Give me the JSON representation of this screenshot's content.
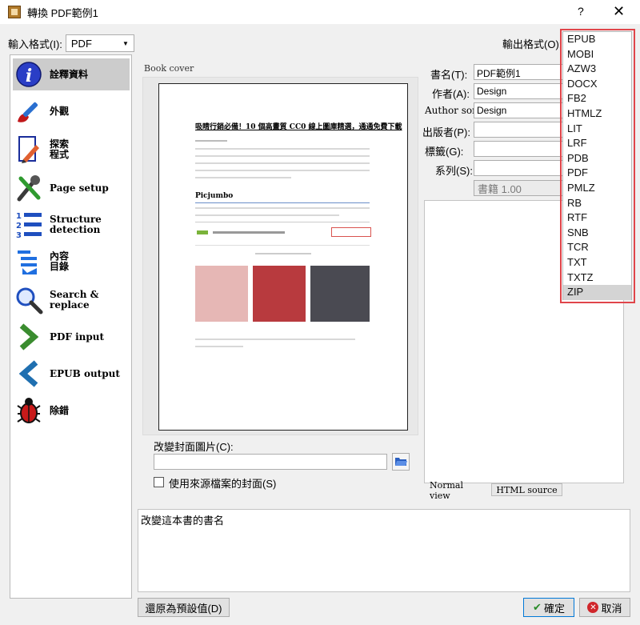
{
  "window": {
    "title": "轉換 PDF範例1",
    "help": "?",
    "close": "✕"
  },
  "input_format": {
    "label": "輸入格式(I):",
    "value": "PDF"
  },
  "output_format": {
    "label": "輸出格式(O):"
  },
  "sidebar": {
    "items": [
      {
        "label": "詮釋資料",
        "icon": "info-icon"
      },
      {
        "label": "外觀",
        "icon": "paintbrush-icon"
      },
      {
        "label": "探索\n程式",
        "icon": "document-pencil-icon"
      },
      {
        "label": "Page setup",
        "icon": "wrench-screwdriver-icon"
      },
      {
        "label": "Structure\ndetection",
        "icon": "numbered-list-icon"
      },
      {
        "label": "內容\n目錄",
        "icon": "toc-list-icon"
      },
      {
        "label": "Search &\nreplace",
        "icon": "magnifier-icon"
      },
      {
        "label": "PDF input",
        "icon": "arrow-right-icon"
      },
      {
        "label": "EPUB output",
        "icon": "arrow-left-icon"
      },
      {
        "label": "除錯",
        "icon": "bug-icon"
      }
    ]
  },
  "cover": {
    "label": "Book cover",
    "preview_title": "吸睛行銷必備！10 個高畫質 CC0 線上圖庫精選，通通免費下載",
    "preview_section": "Picjumbo",
    "change_label": "改變封面圖片(C):",
    "path_value": "",
    "use_source_label": "使用來源檔案的封面(S)"
  },
  "metadata": {
    "title_label": "書名(T):",
    "title_value": "PDF範例1",
    "author_label": "作者(A):",
    "author_value": "Design",
    "author_sort_label": "Author sort:",
    "author_sort_value": "Design",
    "publisher_label": "出版者(P):",
    "publisher_value": "",
    "tags_label": "標籤(G):",
    "tags_value": "",
    "series_label": "系列(S):",
    "series_value": "",
    "series_index": "書籍 1.00"
  },
  "preview_tabs": {
    "normal": "Normal view",
    "html": "HTML source"
  },
  "description": "改變這本書的書名",
  "buttons": {
    "restore": "還原為預設值(D)",
    "ok": "確定",
    "cancel": "取消"
  },
  "dropdown_options": [
    "EPUB",
    "MOBI",
    "AZW3",
    "DOCX",
    "FB2",
    "HTMLZ",
    "LIT",
    "LRF",
    "PDB",
    "PDF",
    "PMLZ",
    "RB",
    "RTF",
    "SNB",
    "TCR",
    "TXT",
    "TXTZ",
    "ZIP"
  ],
  "dropdown_selected": "ZIP",
  "colors": {
    "highlight_frame": "#e0454a",
    "selected_item": "#cccccc"
  }
}
